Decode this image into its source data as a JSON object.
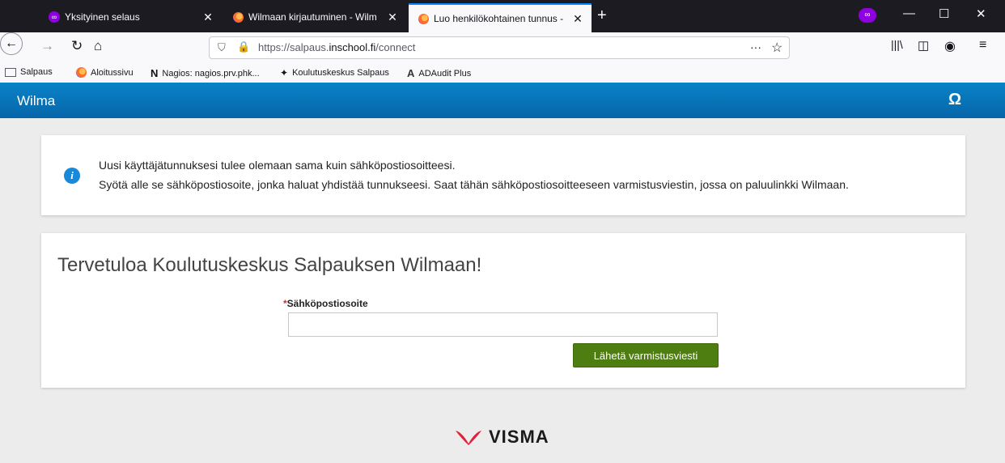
{
  "browser": {
    "tabs": [
      {
        "label": "Yksityinen selaus",
        "icon": "private-mask-icon"
      },
      {
        "label": "Wilmaan kirjautuminen - Wilm",
        "icon": "firefox-icon"
      },
      {
        "label": "Luo henkilökohtainen tunnus -",
        "icon": "firefox-icon"
      }
    ],
    "url_prefix": "https://salpaus.",
    "url_domain": "inschool.fi",
    "url_path": "/connect",
    "bookmarks": [
      {
        "label": "Salpaus",
        "icon": "folder-icon"
      },
      {
        "label": "Aloitussivu",
        "icon": "firefox-icon"
      },
      {
        "label": "Nagios: nagios.prv.phk...",
        "icon": "nagios-icon"
      },
      {
        "label": "Koulutuskeskus Salpaus",
        "icon": "salpaus-icon"
      },
      {
        "label": "ADAudit Plus",
        "icon": "adaudit-icon"
      }
    ]
  },
  "header": {
    "brand": "Wilma",
    "accent_color": "#0a78bf"
  },
  "info": {
    "line1": "Uusi käyttäjätunnuksesi tulee olemaan sama kuin sähköpostiosoitteesi.",
    "line2": "Syötä alle se sähköpostiosoite, jonka haluat yhdistää tunnukseesi. Saat tähän sähköpostiosoitteeseen varmistusviestin, jossa on paluulinkki Wilmaan."
  },
  "form": {
    "title": "Tervetuloa Koulutuskeskus Salpauksen Wilmaan!",
    "required_mark": "*",
    "email_label": "Sähköpostiosoite",
    "email_value": "",
    "submit_label": "Lähetä varmistusviesti",
    "submit_color": "#4e7d12"
  },
  "footer": {
    "logo_text": "VISMA"
  }
}
